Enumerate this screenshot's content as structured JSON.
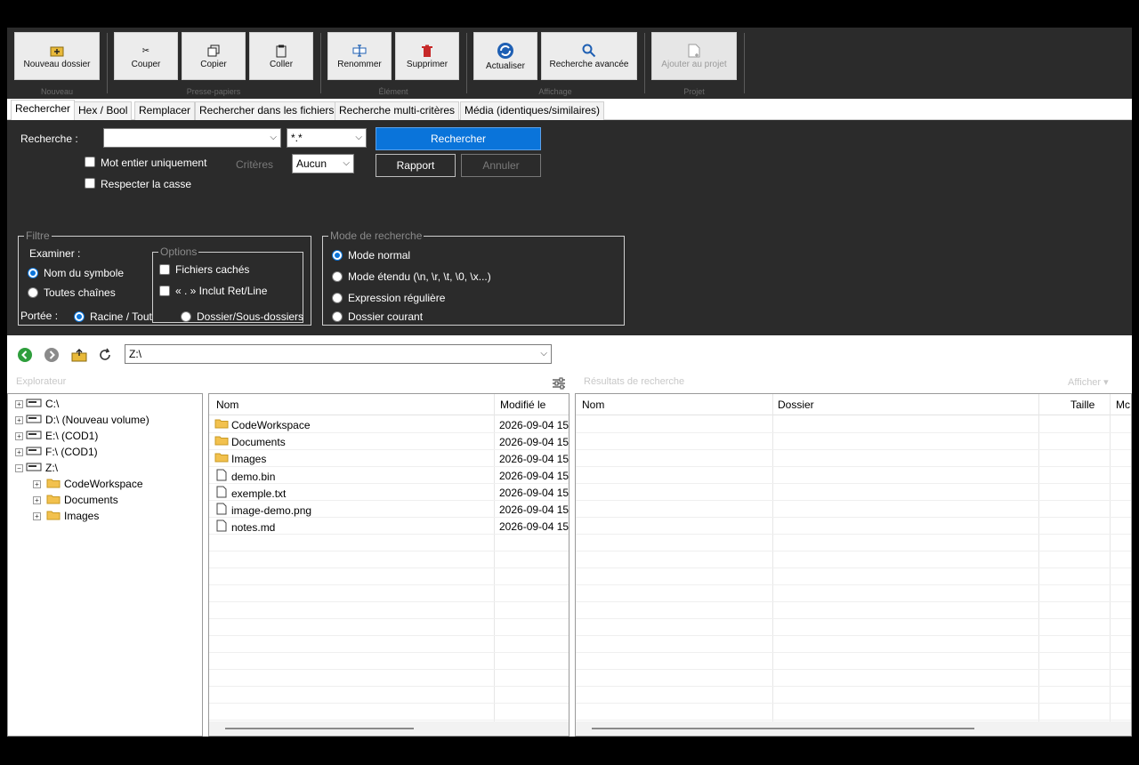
{
  "ribbon": {
    "buttons": [
      {
        "label": "Nouveau dossier",
        "icon": "new-folder-icon"
      },
      {
        "label": "Couper",
        "icon": "scissors-icon"
      },
      {
        "label": "Copier",
        "icon": "copy-icon"
      },
      {
        "label": "Coller",
        "icon": "paste-icon"
      },
      {
        "label": "Renommer",
        "icon": "rename-icon"
      },
      {
        "label": "Supprimer",
        "icon": "trash-icon"
      },
      {
        "label": "Actualiser",
        "icon": "refresh-icon"
      },
      {
        "label": "Recherche avancée",
        "icon": "search-icon"
      },
      {
        "label": "Ajouter au projet",
        "icon": "add-file-icon"
      }
    ],
    "groups": [
      "Nouveau",
      "Presse-papiers",
      "Élément",
      "Affichage",
      "Projet"
    ]
  },
  "tabs": [
    "Rechercher",
    "Hex / Bool",
    "Remplacer",
    "Rechercher dans les fichiers",
    "Recherche multi-critères",
    "Média (identiques/similaires)"
  ],
  "search": {
    "label": "Recherche :",
    "query": "",
    "mask": "*.*",
    "search_button": "Rechercher",
    "report_button": "Rapport",
    "cancel_button": "Annuler",
    "whole_word": "Mot entier uniquement",
    "match_case": "Respecter la casse",
    "criteria_label": "Critères",
    "criteria_value": "Aucun",
    "filter": {
      "legend": "Filtre",
      "examine_label": "Examiner :",
      "symbol_name": "Nom du symbole",
      "all_strings": "Toutes chaînes"
    },
    "options": {
      "legend": "Options",
      "hidden_files": "Fichiers cachés",
      "include_ret": "« . » Inclut Ret/Line"
    },
    "mode": {
      "legend": "Mode de recherche",
      "normal": "Mode normal",
      "extended": "Mode étendu (\\n, \\r, \\t, \\0, \\x...)",
      "regex": "Expression régulière"
    },
    "scope": {
      "label": "Portée :",
      "root": "Racine / Tout",
      "folder_sub": "Dossier/Sous-dossiers",
      "current": "Dossier courant"
    }
  },
  "address": {
    "path": "Z:\\"
  },
  "explorer_title": "Explorateur",
  "results_title": "Résultats de recherche",
  "results_filter": "Afficher ▾",
  "tree": [
    {
      "label": "C:\\",
      "level": 0,
      "kind": "drive",
      "sign": "+"
    },
    {
      "label": "D:\\ (Nouveau volume)",
      "level": 0,
      "kind": "drive",
      "sign": "+"
    },
    {
      "label": "E:\\ (COD1)",
      "level": 0,
      "kind": "drive",
      "sign": "+"
    },
    {
      "label": "F:\\ (COD1)",
      "level": 0,
      "kind": "drive",
      "sign": "+"
    },
    {
      "label": "Z:\\",
      "level": 0,
      "kind": "drive",
      "sign": "−"
    },
    {
      "label": "CodeWorkspace",
      "level": 1,
      "kind": "folder",
      "sign": "+"
    },
    {
      "label": "Documents",
      "level": 1,
      "kind": "folder",
      "sign": "+"
    },
    {
      "label": "Images",
      "level": 1,
      "kind": "folder",
      "sign": "+"
    }
  ],
  "files": {
    "columns": [
      "Nom",
      "Modifié le"
    ],
    "rows": [
      {
        "name": "CodeWorkspace",
        "kind": "folder",
        "modified": "2026-09-04 15:"
      },
      {
        "name": "Documents",
        "kind": "folder",
        "modified": "2026-09-04 15:"
      },
      {
        "name": "Images",
        "kind": "folder",
        "modified": "2026-09-04 15:"
      },
      {
        "name": "demo.bin",
        "kind": "file",
        "modified": "2026-09-04 15:"
      },
      {
        "name": "exemple.txt",
        "kind": "file",
        "modified": "2026-09-04 15:"
      },
      {
        "name": "image-demo.png",
        "kind": "file",
        "modified": "2026-09-04 15:"
      },
      {
        "name": "notes.md",
        "kind": "file",
        "modified": "2026-09-04 15:"
      }
    ]
  },
  "results": {
    "columns": [
      "Nom",
      "Dossier",
      "Taille",
      "Mc"
    ]
  },
  "colors": {
    "accent": "#0a74da",
    "panel_bg": "#2b2b2b",
    "folder": "#f2c14e"
  }
}
